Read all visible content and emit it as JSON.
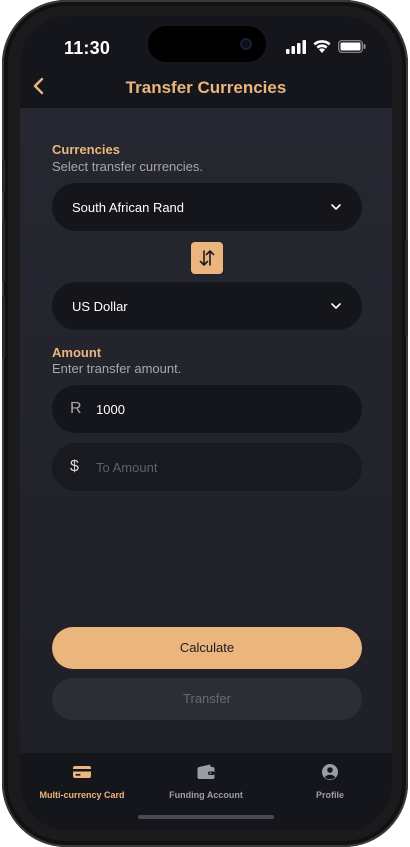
{
  "status_bar": {
    "time": "11:30"
  },
  "header": {
    "title": "Transfer Currencies"
  },
  "currencies": {
    "title": "Currencies",
    "subtitle": "Select transfer currencies.",
    "from_value": "South African Rand",
    "to_value": "US Dollar"
  },
  "amount": {
    "title": "Amount",
    "subtitle": "Enter transfer amount.",
    "from_prefix": "R",
    "from_value": "1000",
    "to_prefix": "$",
    "to_placeholder": "To Amount"
  },
  "actions": {
    "calculate_label": "Calculate",
    "transfer_label": "Transfer"
  },
  "bottom_nav": {
    "items": [
      {
        "label": "Multi-currency Card",
        "icon": "card-icon",
        "active": true
      },
      {
        "label": "Funding Account",
        "icon": "wallet-icon",
        "active": false
      },
      {
        "label": "Profile",
        "icon": "profile-icon",
        "active": false
      }
    ]
  },
  "colors": {
    "accent": "#ebb57e",
    "background": "#23242b",
    "surface": "#15161b"
  }
}
